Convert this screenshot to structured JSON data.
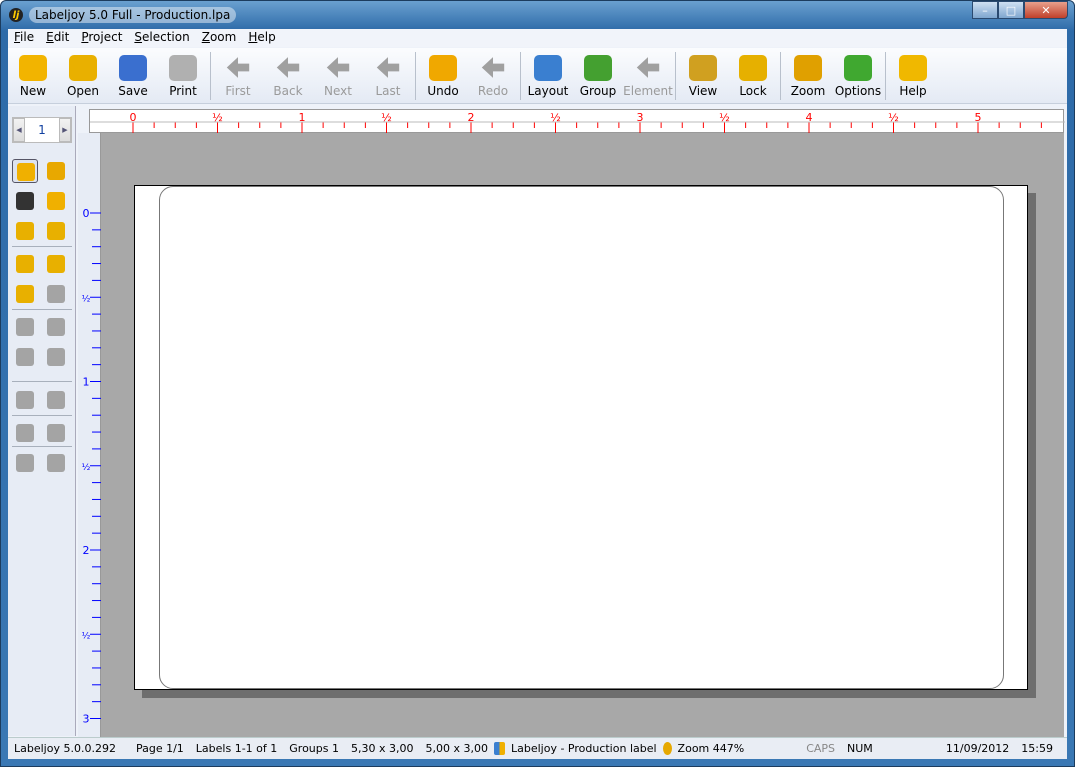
{
  "window": {
    "title": "Labeljoy 5.0 Full - Production.lpa",
    "logo": "lj"
  },
  "menu": [
    {
      "label": "File",
      "key": "F",
      "rest": "ile"
    },
    {
      "label": "Edit",
      "key": "E",
      "rest": "dit"
    },
    {
      "label": "Project",
      "key": "P",
      "rest": "roject"
    },
    {
      "label": "Selection",
      "key": "S",
      "rest": "election"
    },
    {
      "label": "Zoom",
      "key": "Z",
      "rest": "oom"
    },
    {
      "label": "Help",
      "key": "H",
      "rest": "elp"
    }
  ],
  "toolbar": [
    {
      "label": "New",
      "icon": "new-icon",
      "enabled": true,
      "color": "#f2b400"
    },
    {
      "label": "Open",
      "icon": "open-icon",
      "enabled": true,
      "color": "#e9b000"
    },
    {
      "label": "Save",
      "icon": "save-icon",
      "enabled": true,
      "color": "#3a6fcf"
    },
    {
      "label": "Print",
      "icon": "print-icon",
      "enabled": true,
      "color": "#b0b0b0"
    },
    {
      "sep": true
    },
    {
      "label": "First",
      "icon": "first-icon",
      "enabled": false
    },
    {
      "label": "Back",
      "icon": "back-icon",
      "enabled": false
    },
    {
      "label": "Next",
      "icon": "next-icon",
      "enabled": false
    },
    {
      "label": "Last",
      "icon": "last-icon",
      "enabled": false
    },
    {
      "sep": true
    },
    {
      "label": "Undo",
      "icon": "undo-icon",
      "enabled": true,
      "color": "#f0a800"
    },
    {
      "label": "Redo",
      "icon": "redo-icon",
      "enabled": false
    },
    {
      "sep": true
    },
    {
      "label": "Layout",
      "icon": "layout-icon",
      "enabled": true,
      "color": "#3a7fd0"
    },
    {
      "label": "Group",
      "icon": "group-icon",
      "enabled": true,
      "color": "#44a030"
    },
    {
      "label": "Element",
      "icon": "element-icon",
      "enabled": false
    },
    {
      "sep": true
    },
    {
      "label": "View",
      "icon": "eye-icon",
      "enabled": true,
      "color": "#d0a020"
    },
    {
      "label": "Lock",
      "icon": "lock-icon",
      "enabled": true,
      "color": "#e6b000"
    },
    {
      "sep": true
    },
    {
      "label": "Zoom",
      "icon": "zoom-icon",
      "enabled": true,
      "color": "#e0a000"
    },
    {
      "label": "Options",
      "icon": "check-icon",
      "enabled": true,
      "color": "#40a830"
    },
    {
      "sep": true
    },
    {
      "label": "Help",
      "icon": "help-icon",
      "enabled": true,
      "color": "#f0b800"
    }
  ],
  "pager": {
    "value": "1"
  },
  "ruler": {
    "top_labels": [
      "0",
      "½",
      "1",
      "½",
      "2",
      "½",
      "3",
      "½",
      "4",
      "½",
      "5"
    ],
    "left_labels": [
      "0",
      "½",
      "1",
      "½",
      "2",
      "½",
      "3"
    ],
    "top_color": "#ff0000",
    "left_color": "#0000ff"
  },
  "status": {
    "version": "Labeljoy 5.0.0.292",
    "page": "Page 1/1",
    "labels": "Labels 1-1 of 1",
    "groups": "Groups 1",
    "size1": "5,30 x 3,00",
    "size2": "5,00 x 3,00",
    "layout": "Labeljoy - Production label",
    "zoom": "Zoom 447%",
    "caps": "CAPS",
    "num": "NUM",
    "date": "11/09/2012",
    "time": "15:59"
  }
}
